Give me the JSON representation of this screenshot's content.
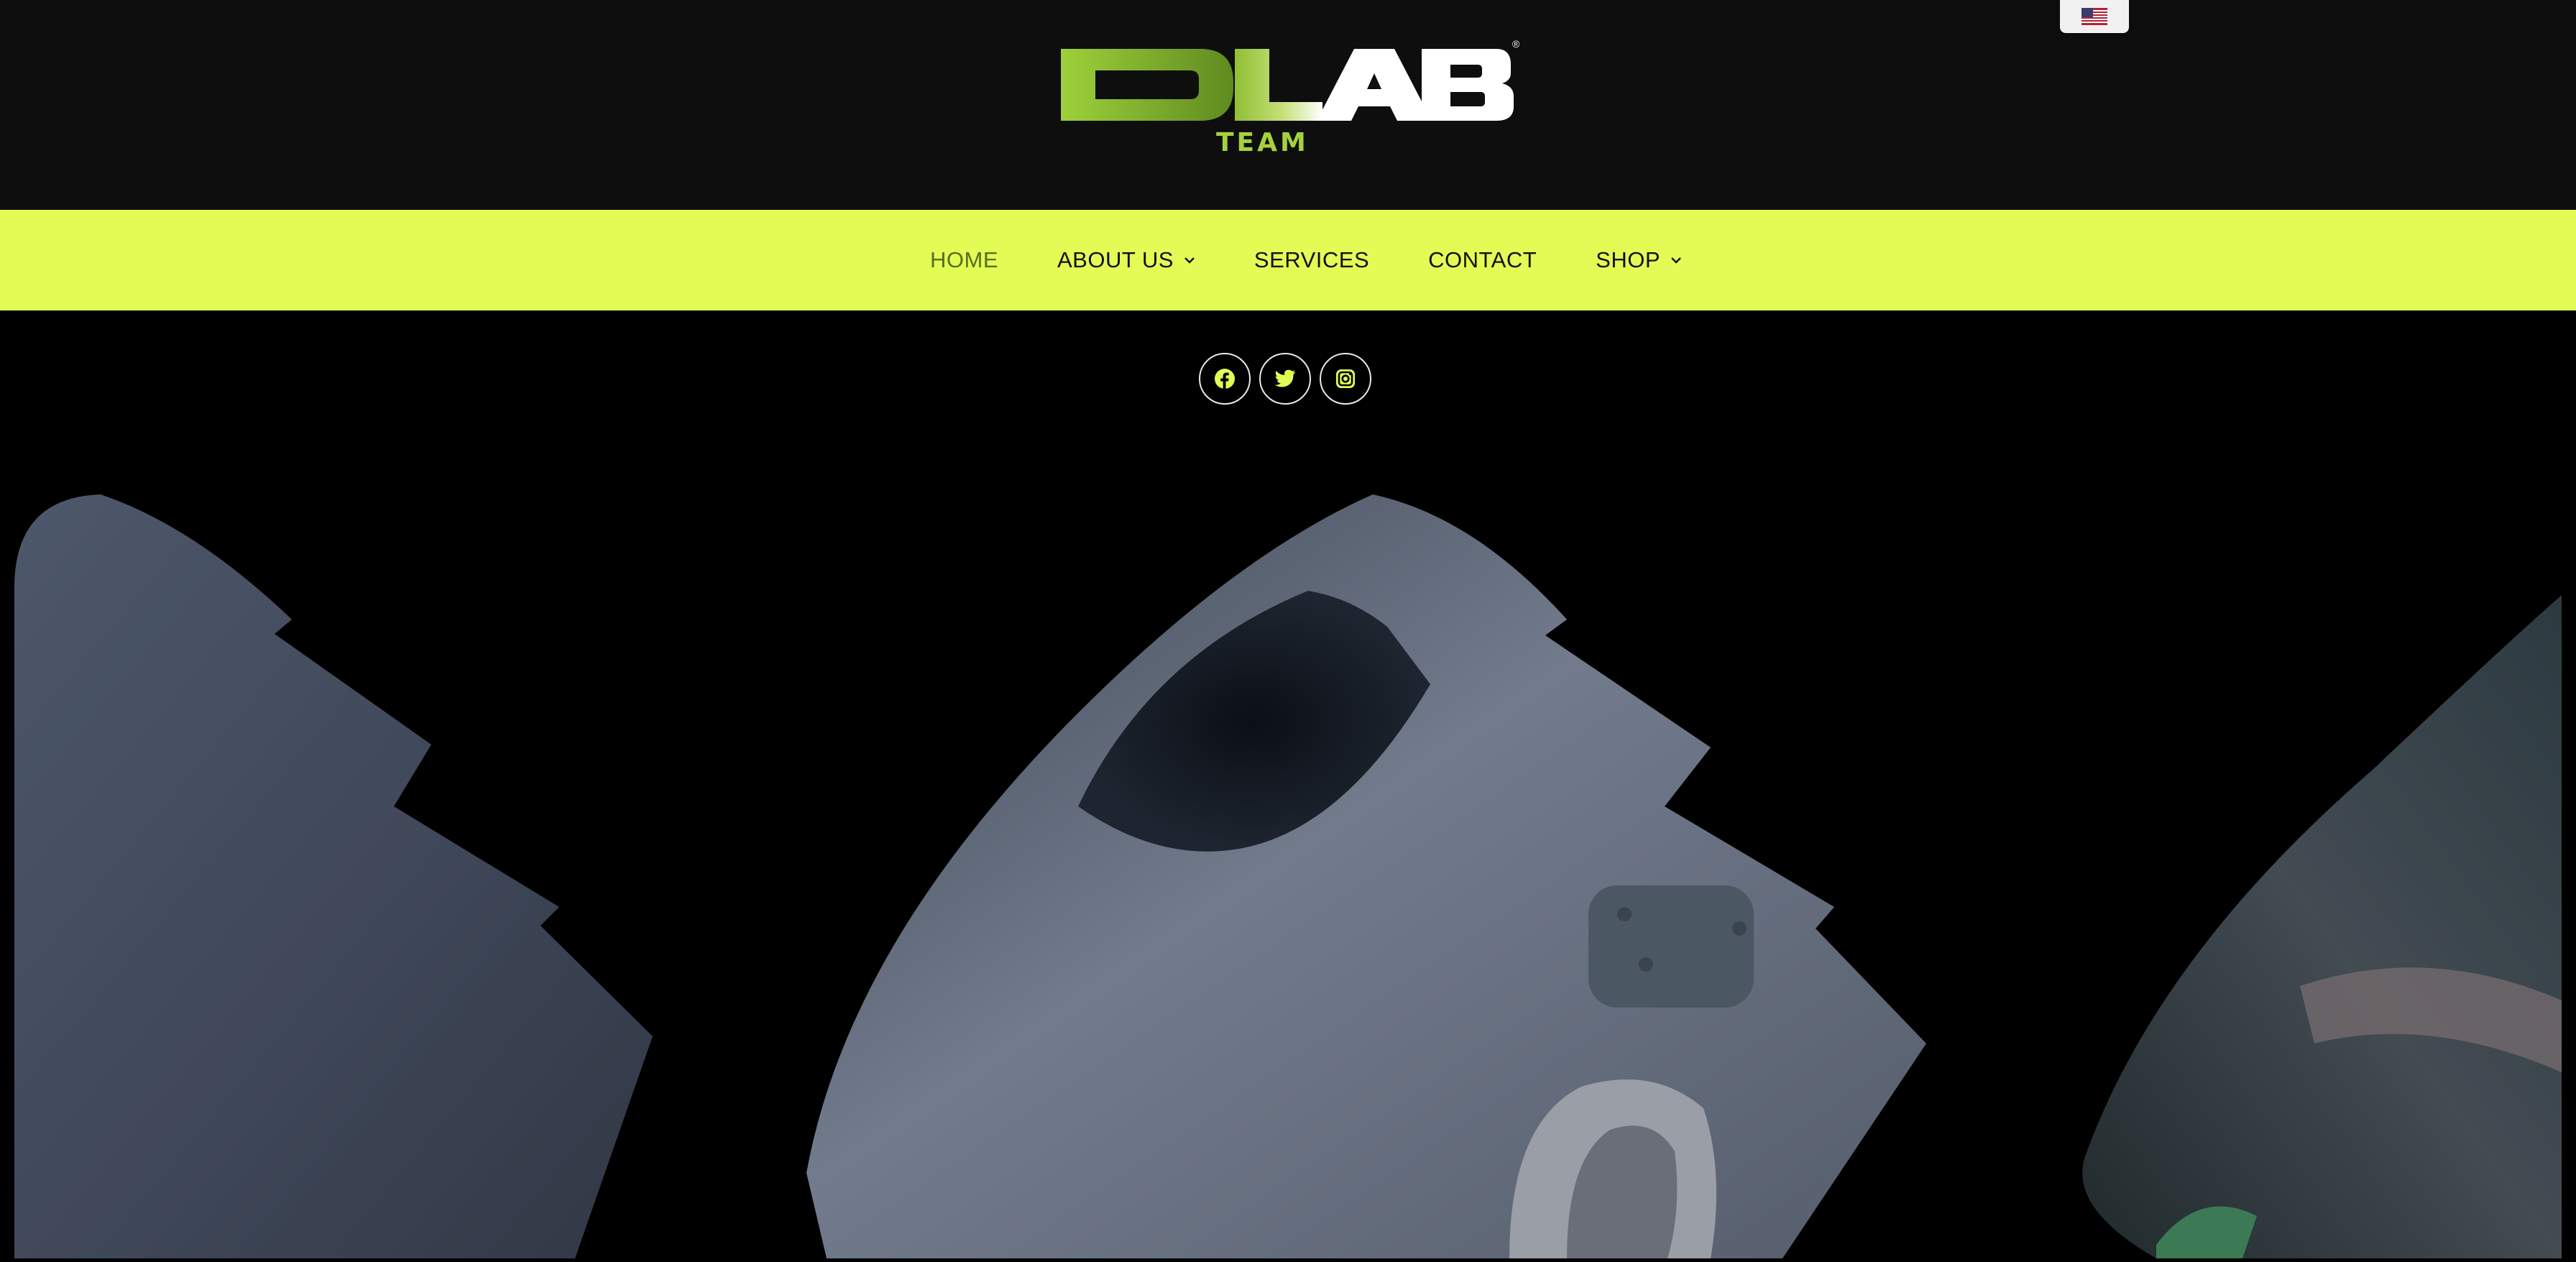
{
  "logo": {
    "main_text": "DLAB",
    "sub_text": "TEAM",
    "registered_mark": "®"
  },
  "language": {
    "current": "English (US)",
    "icon": "us-flag-icon"
  },
  "nav": {
    "items": [
      {
        "label": "HOME",
        "active": true,
        "has_dropdown": false
      },
      {
        "label": "ABOUT US",
        "active": false,
        "has_dropdown": true
      },
      {
        "label": "SERVICES",
        "active": false,
        "has_dropdown": false
      },
      {
        "label": "CONTACT",
        "active": false,
        "has_dropdown": false
      },
      {
        "label": "SHOP",
        "active": false,
        "has_dropdown": true
      }
    ]
  },
  "social": [
    {
      "name": "facebook",
      "icon": "facebook-icon"
    },
    {
      "name": "twitter",
      "icon": "twitter-icon"
    },
    {
      "name": "instagram",
      "icon": "instagram-icon"
    }
  ],
  "colors": {
    "header_bg": "#0e0e0f",
    "nav_bg": "#e2fc55",
    "accent_green": "#8cb833",
    "social_icon": "#e2fc55",
    "page_bg": "#000000"
  }
}
